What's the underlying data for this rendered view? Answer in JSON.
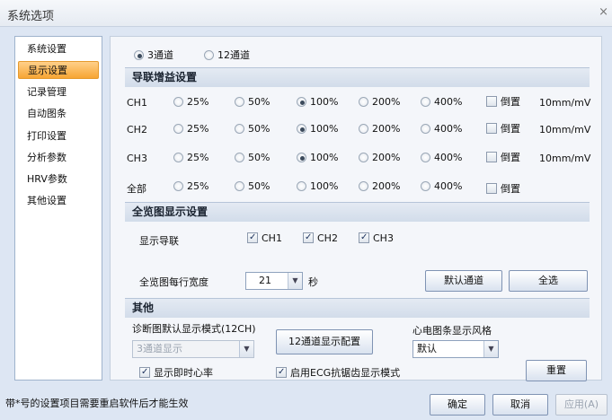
{
  "window": {
    "title": "系统选项",
    "close": "×"
  },
  "sidebar": {
    "items": [
      {
        "label": "系统设置"
      },
      {
        "label": "显示设置"
      },
      {
        "label": "记录管理"
      },
      {
        "label": "自动图条"
      },
      {
        "label": "打印设置"
      },
      {
        "label": "分析参数"
      },
      {
        "label": "HRV参数"
      },
      {
        "label": "其他设置"
      }
    ]
  },
  "channels_mode": {
    "option1": "3通道",
    "option2": "12通道",
    "selected": "3通道"
  },
  "gain": {
    "title": "导联增益设置",
    "rows": [
      {
        "label": "CH1",
        "options": [
          "25%",
          "50%",
          "100%",
          "200%",
          "400%"
        ],
        "selected": "100%",
        "invert": "倒置",
        "unit": "10mm/mV"
      },
      {
        "label": "CH2",
        "options": [
          "25%",
          "50%",
          "100%",
          "200%",
          "400%"
        ],
        "selected": "100%",
        "invert": "倒置",
        "unit": "10mm/mV"
      },
      {
        "label": "CH3",
        "options": [
          "25%",
          "50%",
          "100%",
          "200%",
          "400%"
        ],
        "selected": "100%",
        "invert": "倒置",
        "unit": "10mm/mV"
      },
      {
        "label": "全部",
        "options": [
          "25%",
          "50%",
          "100%",
          "200%",
          "400%"
        ],
        "selected": "",
        "invert": "倒置",
        "unit": ""
      }
    ]
  },
  "overview": {
    "title": "全览图显示设置",
    "leads_label": "显示导联",
    "leads": [
      "CH1",
      "CH2",
      "CH3"
    ],
    "width_label": "全览图每行宽度",
    "width_value": "21",
    "width_unit": "秒",
    "default_button": "默认通道",
    "select_all_button": "全选"
  },
  "other": {
    "title": "其他",
    "diag_label": "诊断图默认显示模式(12CH)",
    "diag_value": "3通道显示",
    "config_button": "12通道显示配置",
    "style_label": "心电图条显示风格",
    "style_value": "默认",
    "show_hr": "显示即时心率",
    "antialias": "启用ECG抗锯齿显示模式",
    "reset_button": "重置"
  },
  "footer": {
    "note": "带*号的设置项目需要重启软件后才能生效",
    "ok": "确定",
    "cancel": "取消",
    "apply": "应用(A)"
  }
}
